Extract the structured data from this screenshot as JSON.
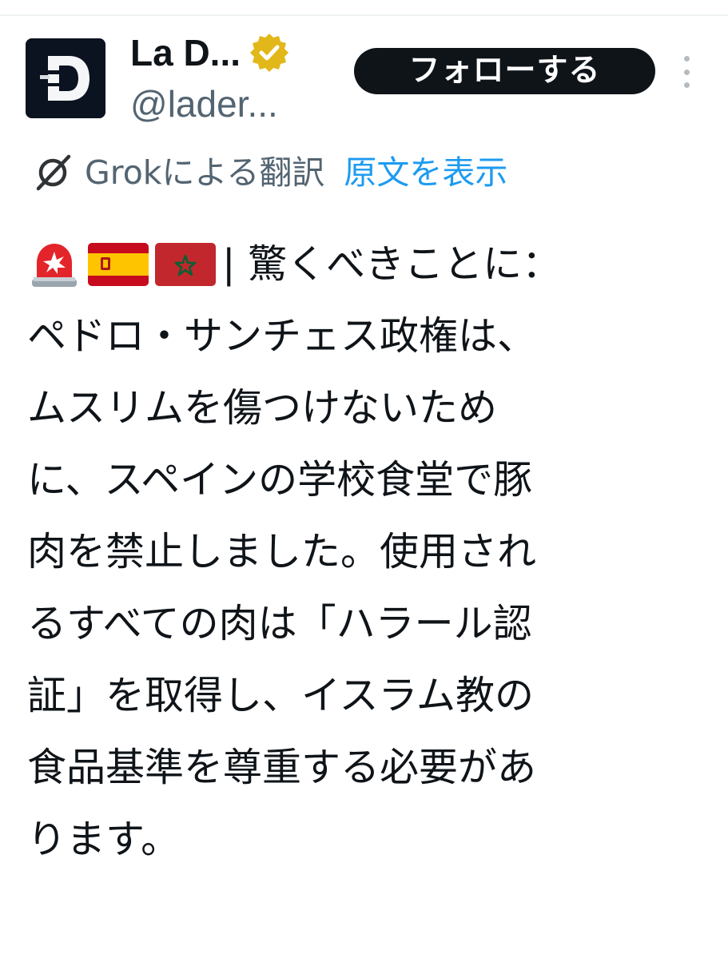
{
  "author": {
    "display_name": "La D...",
    "handle": "@lader...",
    "verified_badge_color": "#e2b719",
    "avatar_letter": "D"
  },
  "follow_button": {
    "label": "フォローする"
  },
  "more_menu": {
    "icon": "more-vertical-icon"
  },
  "translation": {
    "icon": "grok-icon",
    "label": "Grokによる翻訳",
    "show_original_label": "原文を表示"
  },
  "tweet": {
    "emojis": [
      "rotating-light-emoji",
      "spain-flag-emoji",
      "morocco-flag-emoji"
    ],
    "lines": [
      "| 驚くべきことに：",
      "ペドロ・サンチェス政権は、",
      "ムスリムを傷つけないため",
      "に、スペインの学校食堂で豚",
      "肉を禁止しました。使用され",
      "るすべての肉は「ハラール認",
      "証」を取得し、イスラム教の",
      "食品基準を尊重する必要があ",
      "ります。"
    ]
  },
  "colors": {
    "text": "#0f1419",
    "secondary_text": "#536471",
    "link": "#1d9bf0",
    "button_bg": "#0f1419"
  }
}
